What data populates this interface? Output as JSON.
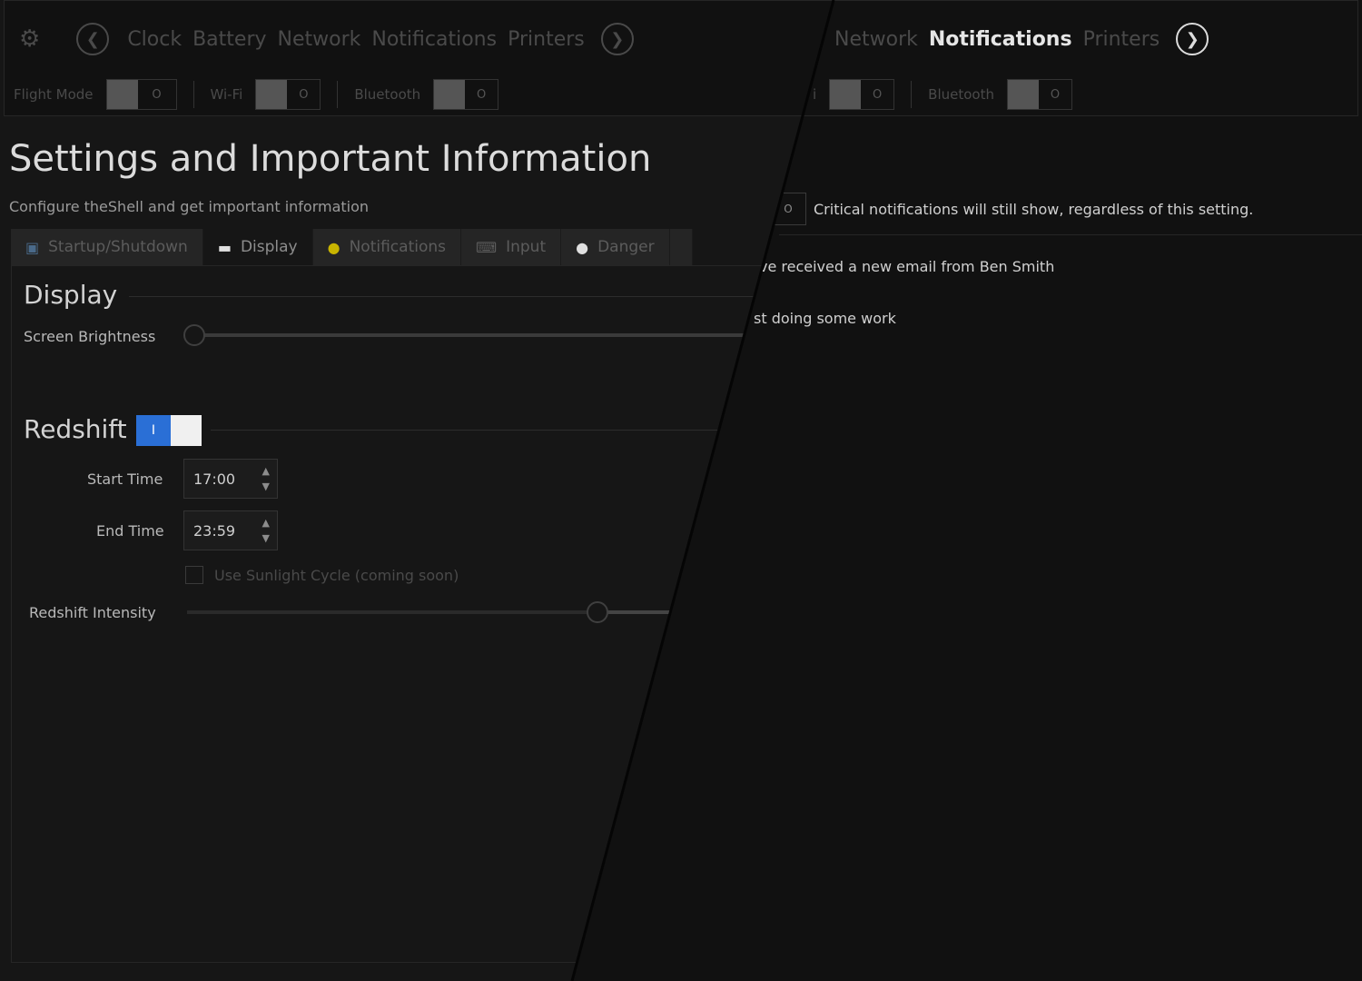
{
  "left": {
    "nav": {
      "items": [
        "Clock",
        "Battery",
        "Network",
        "Notifications",
        "Printers"
      ]
    },
    "toggles": [
      {
        "label": "Flight Mode",
        "state": "O"
      },
      {
        "label": "Wi-Fi",
        "state": "O"
      },
      {
        "label": "Bluetooth",
        "state": "O"
      }
    ],
    "title": "Settings and Important Information",
    "subtitle": "Configure theShell and get important information",
    "tabs": [
      {
        "label": "Startup/Shutdown",
        "icon": "monitor-icon"
      },
      {
        "label": "Display",
        "icon": "display-icon"
      },
      {
        "label": "Notifications",
        "icon": "warning-icon"
      },
      {
        "label": "Input",
        "icon": "keyboard-icon"
      },
      {
        "label": "Danger",
        "icon": "danger-icon"
      }
    ],
    "display": {
      "heading": "Display",
      "brightness_label": "Screen Brightness",
      "brightness_value": 0
    },
    "redshift": {
      "heading": "Redshift",
      "toggle_state": "I",
      "start_label": "Start Time",
      "start_value": "17:00",
      "end_label": "End Time",
      "end_value": "23:59",
      "sunlight_label": "Use Sunlight Cycle (coming soon)",
      "intensity_label": "Redshift Intensity",
      "intensity_value": 0.85
    }
  },
  "right": {
    "nav": {
      "items": [
        "Network",
        "Notifications",
        "Printers"
      ],
      "active": "Notifications"
    },
    "toggles": [
      {
        "label": "Bluetooth",
        "state": "O"
      }
    ],
    "partial_toggle_state": "O",
    "wifi_fragment": "i",
    "dnd_state": "O",
    "critical_note": "Critical notifications will still show, regardless of this setting.",
    "notif1": "ve received a new email from Ben Smith",
    "notif2": "st doing some work"
  },
  "colors": {
    "accent": "#2a6fd6",
    "background": "#141414"
  }
}
